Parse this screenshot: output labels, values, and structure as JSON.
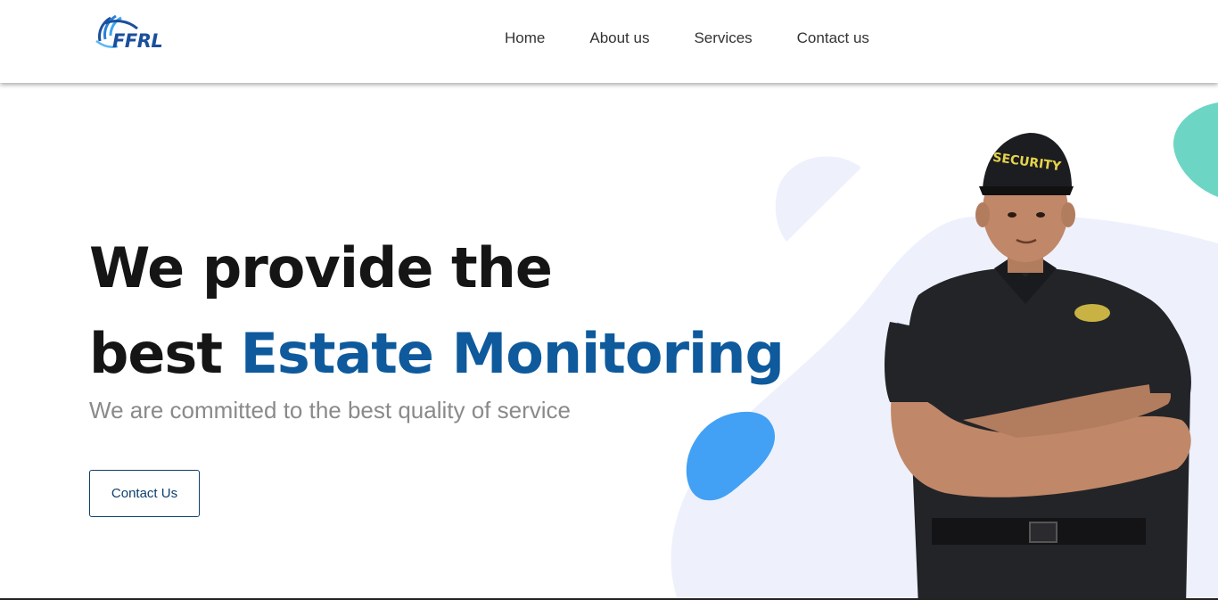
{
  "brand": {
    "logo_text": "FFRL"
  },
  "nav": {
    "items": [
      {
        "label": "Home"
      },
      {
        "label": "About us"
      },
      {
        "label": "Services"
      },
      {
        "label": "Contact us"
      }
    ]
  },
  "hero": {
    "headline_line1": "We provide the",
    "headline_line2_plain": "best ",
    "headline_line2_accent": "Estate Monitoring",
    "subtitle": "We are committed to the best quality of service",
    "cta_label": "Contact Us",
    "image_badge_text": "SECURITY"
  },
  "colors": {
    "accent": "#0e5a9c",
    "blob_light": "#eef1fc",
    "blob_blue": "#42a1f5",
    "blob_teal": "#6dd5c4"
  }
}
